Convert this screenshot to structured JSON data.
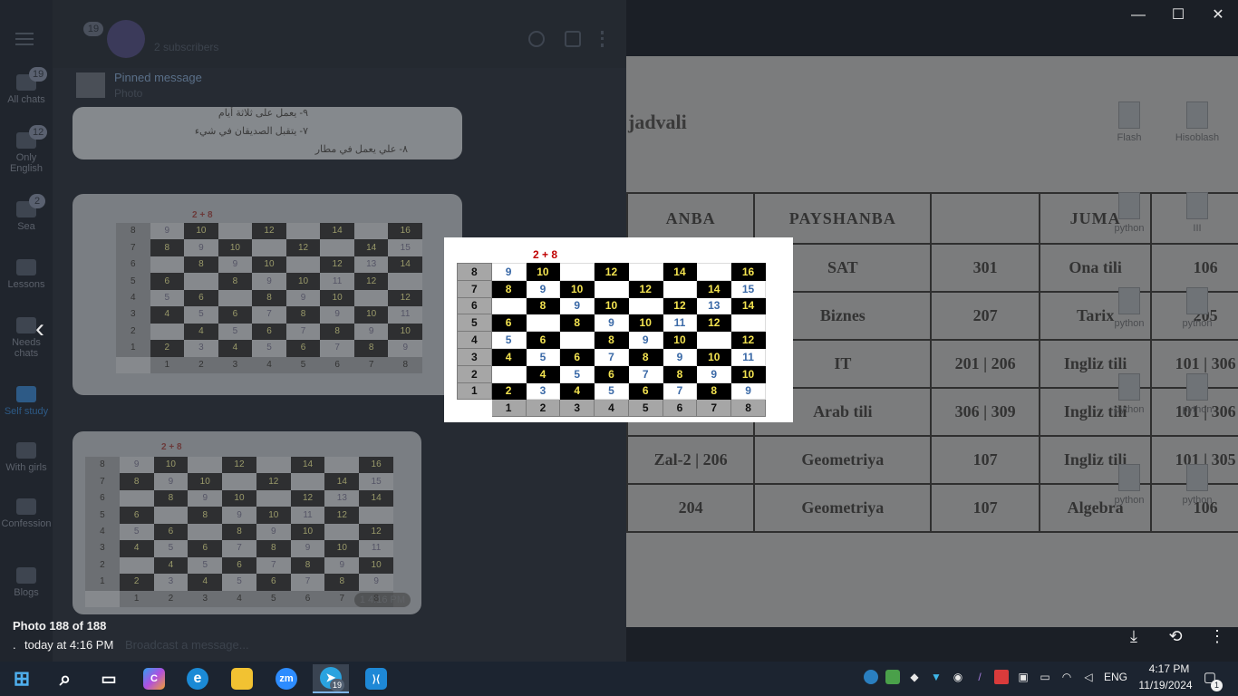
{
  "rail": {
    "items": [
      {
        "label": "All chats",
        "badge": "19"
      },
      {
        "label": "Only English",
        "badge": "12"
      },
      {
        "label": "Sea",
        "badge": "2"
      },
      {
        "label": "Lessons",
        "badge": ""
      },
      {
        "label": "Needs chats",
        "badge": ""
      },
      {
        "label": "Self study",
        "badge": ""
      },
      {
        "label": "With girls",
        "badge": ""
      },
      {
        "label": "Confession",
        "badge": ""
      },
      {
        "label": "Blogs",
        "badge": ""
      }
    ]
  },
  "chat": {
    "back_badge": "19",
    "subtitle": "2 subscribers",
    "pinned_title": "Pinned message",
    "pinned_sub": "Photo",
    "rtl_lines": [
      "٩- يعمل على ثلاثة أيام",
      "٧- يتقبل الصديقان في شيء",
      "٨- علي يعمل في مطار"
    ],
    "input_placeholder": "Broadcast a message...",
    "bubble_meta": "1  4:16 PM"
  },
  "background_doc": {
    "title": "jadvali",
    "rows": [
      [
        "ANBA",
        "PAYSHANBA",
        "",
        "JUMA",
        ""
      ],
      [
        "",
        "SAT",
        "301",
        "Ona tili",
        "106"
      ],
      [
        "",
        "Biznes",
        "207",
        "Tarix",
        "205"
      ],
      [
        "",
        "IT",
        "201 | 206",
        "Ingliz tili",
        "101 | 306"
      ],
      [
        "",
        "Arab tili",
        "306 | 309",
        "Ingliz tili",
        "101 | 306"
      ],
      [
        "Zal-2 | 206",
        "Geometriya",
        "107",
        "Ingliz tili",
        "101 | 305"
      ],
      [
        "204",
        "Geometriya",
        "107",
        "Algebra",
        "106"
      ]
    ],
    "desktop_icons": [
      "Flash",
      "Hisoblash",
      "python",
      "III",
      "python",
      "python",
      "python",
      "python",
      "python",
      "python"
    ]
  },
  "viewer": {
    "photo_title": "2 + 8",
    "grid": [
      [
        {
          "v": "8",
          "c": "g"
        },
        {
          "v": "9",
          "c": "w"
        },
        {
          "v": "10",
          "c": "k"
        },
        {
          "v": "",
          "c": "w"
        },
        {
          "v": "12",
          "c": "k"
        },
        {
          "v": "",
          "c": "w"
        },
        {
          "v": "14",
          "c": "k"
        },
        {
          "v": "",
          "c": "w"
        },
        {
          "v": "16",
          "c": "k"
        }
      ],
      [
        {
          "v": "7",
          "c": "g"
        },
        {
          "v": "8",
          "c": "k"
        },
        {
          "v": "9",
          "c": "w"
        },
        {
          "v": "10",
          "c": "k"
        },
        {
          "v": "",
          "c": "w"
        },
        {
          "v": "12",
          "c": "k"
        },
        {
          "v": "",
          "c": "w"
        },
        {
          "v": "14",
          "c": "k"
        },
        {
          "v": "15",
          "c": "w"
        }
      ],
      [
        {
          "v": "6",
          "c": "g"
        },
        {
          "v": "",
          "c": "w"
        },
        {
          "v": "8",
          "c": "k"
        },
        {
          "v": "9",
          "c": "w"
        },
        {
          "v": "10",
          "c": "k"
        },
        {
          "v": "",
          "c": "w"
        },
        {
          "v": "12",
          "c": "k"
        },
        {
          "v": "13",
          "c": "w"
        },
        {
          "v": "14",
          "c": "k"
        }
      ],
      [
        {
          "v": "5",
          "c": "g"
        },
        {
          "v": "6",
          "c": "k"
        },
        {
          "v": "",
          "c": "w"
        },
        {
          "v": "8",
          "c": "k"
        },
        {
          "v": "9",
          "c": "w"
        },
        {
          "v": "10",
          "c": "k"
        },
        {
          "v": "11",
          "c": "w"
        },
        {
          "v": "12",
          "c": "k"
        },
        {
          "v": "",
          "c": "w"
        }
      ],
      [
        {
          "v": "4",
          "c": "g"
        },
        {
          "v": "5",
          "c": "w"
        },
        {
          "v": "6",
          "c": "k"
        },
        {
          "v": "",
          "c": "w"
        },
        {
          "v": "8",
          "c": "k"
        },
        {
          "v": "9",
          "c": "w"
        },
        {
          "v": "10",
          "c": "k"
        },
        {
          "v": "",
          "c": "w"
        },
        {
          "v": "12",
          "c": "k"
        }
      ],
      [
        {
          "v": "3",
          "c": "g"
        },
        {
          "v": "4",
          "c": "k"
        },
        {
          "v": "5",
          "c": "w"
        },
        {
          "v": "6",
          "c": "k"
        },
        {
          "v": "7",
          "c": "w"
        },
        {
          "v": "8",
          "c": "k"
        },
        {
          "v": "9",
          "c": "w"
        },
        {
          "v": "10",
          "c": "k"
        },
        {
          "v": "11",
          "c": "w"
        }
      ],
      [
        {
          "v": "2",
          "c": "g"
        },
        {
          "v": "",
          "c": "w"
        },
        {
          "v": "4",
          "c": "k"
        },
        {
          "v": "5",
          "c": "w"
        },
        {
          "v": "6",
          "c": "k"
        },
        {
          "v": "7",
          "c": "w"
        },
        {
          "v": "8",
          "c": "k"
        },
        {
          "v": "9",
          "c": "w"
        },
        {
          "v": "10",
          "c": "k"
        }
      ],
      [
        {
          "v": "1",
          "c": "g"
        },
        {
          "v": "2",
          "c": "k"
        },
        {
          "v": "3",
          "c": "w"
        },
        {
          "v": "4",
          "c": "k"
        },
        {
          "v": "5",
          "c": "w"
        },
        {
          "v": "6",
          "c": "k"
        },
        {
          "v": "7",
          "c": "w"
        },
        {
          "v": "8",
          "c": "k"
        },
        {
          "v": "9",
          "c": "w"
        }
      ],
      [
        {
          "v": "",
          "c": "e"
        },
        {
          "v": "1",
          "c": "g"
        },
        {
          "v": "2",
          "c": "g"
        },
        {
          "v": "3",
          "c": "g"
        },
        {
          "v": "4",
          "c": "g"
        },
        {
          "v": "5",
          "c": "g"
        },
        {
          "v": "6",
          "c": "g"
        },
        {
          "v": "7",
          "c": "g"
        },
        {
          "v": "8",
          "c": "g"
        }
      ]
    ],
    "counter": "Photo 188 of 188",
    "date_dot": ".",
    "date": "today at 4:16 PM",
    "controls": {
      "minimize": "—",
      "maximize": "☐",
      "close": "✕",
      "prev": "‹",
      "download": "⤓",
      "rotate": "⟲",
      "more": "⋮"
    }
  },
  "taskbar": {
    "apps": [
      {
        "name": "start",
        "glyph": "⊞"
      },
      {
        "name": "search",
        "glyph": "⌕"
      },
      {
        "name": "task-view",
        "glyph": "▭"
      },
      {
        "name": "copilot",
        "glyph": "C"
      },
      {
        "name": "edge",
        "glyph": "e"
      },
      {
        "name": "file-explorer",
        "glyph": "▬"
      },
      {
        "name": "zoom",
        "glyph": "zm"
      },
      {
        "name": "telegram",
        "glyph": "➤"
      },
      {
        "name": "vscode",
        "glyph": "⟩⟨"
      }
    ],
    "telegram_badge": "19",
    "language": "ENG",
    "time": "4:17 PM",
    "date": "11/19/2024",
    "notification_badge": "1"
  },
  "colors": {
    "viewer_black_cell": "#000000",
    "viewer_yellow_text": "#f2e250",
    "viewer_blue_text": "#3a69a7",
    "viewer_gray_cell": "#a6a6a6",
    "viewer_title_red": "#c00000",
    "taskbar_bg": "#1c2430"
  }
}
